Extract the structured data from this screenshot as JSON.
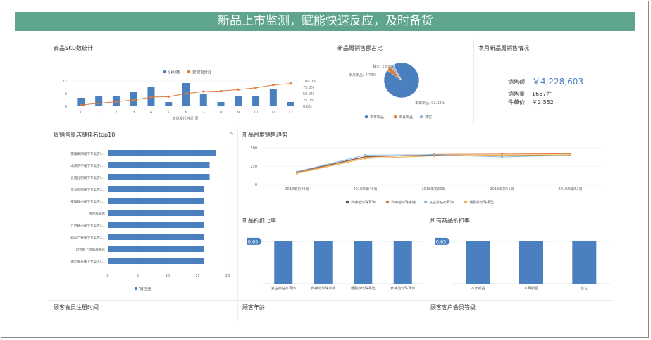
{
  "banner": {
    "title": "新品上市监测，赋能快速反应，及时备货"
  },
  "sku_panel": {
    "title": "商品SKU数统计"
  },
  "share_panel": {
    "title": "新品周销售额占比"
  },
  "kpi_panel": {
    "title": "本月新品周销售情况",
    "sales_label": "销售额",
    "sales_value": "￥4,228,603",
    "qty_label": "销售量",
    "qty_value": "1657件",
    "price_label": "件单价",
    "price_value": "￥2,552"
  },
  "rank_panel": {
    "title": "周销售量店铺排名top10"
  },
  "trend_panel": {
    "title": "新品月度销售趋势"
  },
  "disc_panel": {
    "title": "新品折扣比率"
  },
  "alldisc_panel": {
    "title": "所有商品折扣率"
  },
  "reg_panel": {
    "title": "顾客会员注册时间"
  },
  "age_panel": {
    "title": "顾客年龄"
  },
  "level_panel": {
    "title": "顾客客户会员等级"
  },
  "colors": {
    "blue": "#4a7fc0",
    "orange": "#e07b39",
    "gray": "#555555",
    "light_blue": "#8fb8e0",
    "teal": "#5fa48f"
  },
  "chart_data": [
    {
      "id": "sku",
      "type": "bar",
      "categories": [
        "0",
        "1",
        "2",
        "3",
        "4",
        "5",
        "6",
        "7",
        "8",
        "9",
        "10",
        "11",
        "12"
      ],
      "series": [
        {
          "name": "SKU数",
          "values": [
            4,
            5,
            5,
            7,
            9,
            2,
            11,
            6,
            2,
            5,
            5,
            8,
            2
          ]
        },
        {
          "name": "累积百分比",
          "values": [
            5,
            12,
            18,
            25,
            36,
            38,
            50,
            58,
            60,
            66,
            73,
            84,
            90
          ]
        }
      ],
      "xlabel": "商品发行时间(周)",
      "y_ticks": [
        "12",
        "6",
        "0"
      ],
      "y2_ticks": [
        "100.0%",
        "75.0%",
        "50.0%",
        "25.0%",
        "0.0%"
      ],
      "ylim": [
        0,
        12
      ],
      "y2lim": [
        0,
        100
      ]
    },
    {
      "id": "share",
      "type": "pie",
      "slices": [
        {
          "name": "本年新品",
          "value": 92.32
        },
        {
          "name": "本月新品",
          "value": 4.79
        },
        {
          "name": "其它",
          "value": 2.89
        }
      ],
      "labels": [
        "其它: 2.89%",
        "本月新品: 4.79%",
        "本年新品: 92.32%"
      ],
      "legend": [
        "本年新品",
        "本月新品",
        "其它"
      ]
    },
    {
      "id": "rank",
      "type": "bar",
      "orientation": "horizontal",
      "categories": [
        "安徽阜阳线下专卖店3...",
        "山东济宁线下专卖店4...",
        "云南昆明线下专卖店3...",
        "贵州贵阳线下专卖店3...",
        "安徽滁州线下专卖店4...",
        "京东旗舰店",
        "江西赣州线下专卖店3...",
        "四川广安线下专卖店3...",
        "自营网上商城旗舰店",
        "湖北黄石线下专卖店4..."
      ],
      "values": [
        18,
        17,
        17,
        16,
        16,
        16,
        16,
        16,
        16,
        16
      ],
      "x_ticks": [
        "0",
        "5",
        "10",
        "15",
        "20"
      ],
      "xlim": [
        0,
        20
      ],
      "legend": [
        "销售量"
      ]
    },
    {
      "id": "trend",
      "type": "line",
      "x": [
        "2018年第48周",
        "2018年第49周",
        "2018年第50周",
        "2018年第51周",
        "2018年第52周"
      ],
      "series": [
        {
          "name": "女神范珍珠耳饰",
          "values": [
            170,
            380,
            400,
            390,
            400
          ]
        },
        {
          "name": "女神范珍珠手链",
          "values": [
            160,
            370,
            410,
            415,
            420
          ]
        },
        {
          "name": "复古款钻石耳饰",
          "values": [
            175,
            400,
            405,
            375,
            400
          ]
        },
        {
          "name": "通勤款珍珠吊坠",
          "values": [
            150,
            355,
            390,
            400,
            405
          ]
        }
      ],
      "y_ticks": [
        "500",
        "250",
        "0"
      ],
      "ylim": [
        0,
        500
      ]
    },
    {
      "id": "disc",
      "type": "bar",
      "categories": [
        "复古款钻石耳饰",
        "女神范珍珠手链",
        "通勤款珍珠吊坠",
        "女神范珍珠耳饰"
      ],
      "values": [
        0.65,
        0.65,
        0.65,
        0.65
      ],
      "ref_label": "0.65",
      "ylim": [
        0,
        0.8
      ]
    },
    {
      "id": "alldisc",
      "type": "bar",
      "categories": [
        "本年新品",
        "本月新品",
        "其它"
      ],
      "values": [
        0.65,
        0.65,
        0.66
      ],
      "ref_label": "0.65",
      "ylim": [
        0,
        0.8
      ]
    }
  ]
}
